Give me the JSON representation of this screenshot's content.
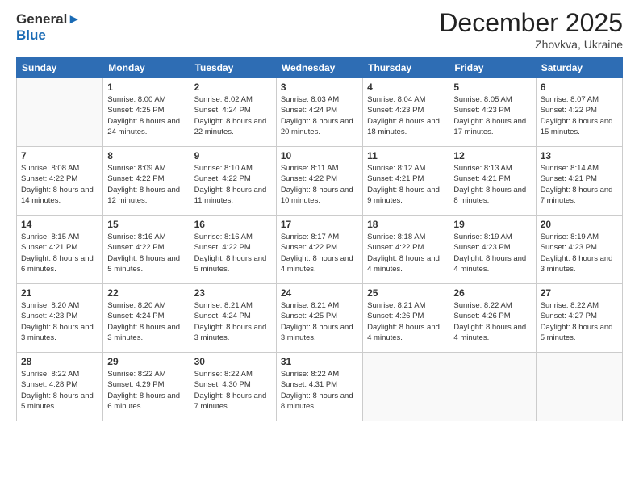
{
  "header": {
    "logo_line1": "General",
    "logo_line2": "Blue",
    "month": "December 2025",
    "location": "Zhovkva, Ukraine"
  },
  "weekdays": [
    "Sunday",
    "Monday",
    "Tuesday",
    "Wednesday",
    "Thursday",
    "Friday",
    "Saturday"
  ],
  "weeks": [
    [
      {
        "day": "",
        "empty": true
      },
      {
        "day": "1",
        "sunrise": "8:00 AM",
        "sunset": "4:25 PM",
        "daylight": "8 hours and 24 minutes."
      },
      {
        "day": "2",
        "sunrise": "8:02 AM",
        "sunset": "4:24 PM",
        "daylight": "8 hours and 22 minutes."
      },
      {
        "day": "3",
        "sunrise": "8:03 AM",
        "sunset": "4:24 PM",
        "daylight": "8 hours and 20 minutes."
      },
      {
        "day": "4",
        "sunrise": "8:04 AM",
        "sunset": "4:23 PM",
        "daylight": "8 hours and 18 minutes."
      },
      {
        "day": "5",
        "sunrise": "8:05 AM",
        "sunset": "4:23 PM",
        "daylight": "8 hours and 17 minutes."
      },
      {
        "day": "6",
        "sunrise": "8:07 AM",
        "sunset": "4:22 PM",
        "daylight": "8 hours and 15 minutes."
      }
    ],
    [
      {
        "day": "7",
        "sunrise": "8:08 AM",
        "sunset": "4:22 PM",
        "daylight": "8 hours and 14 minutes."
      },
      {
        "day": "8",
        "sunrise": "8:09 AM",
        "sunset": "4:22 PM",
        "daylight": "8 hours and 12 minutes."
      },
      {
        "day": "9",
        "sunrise": "8:10 AM",
        "sunset": "4:22 PM",
        "daylight": "8 hours and 11 minutes."
      },
      {
        "day": "10",
        "sunrise": "8:11 AM",
        "sunset": "4:22 PM",
        "daylight": "8 hours and 10 minutes."
      },
      {
        "day": "11",
        "sunrise": "8:12 AM",
        "sunset": "4:21 PM",
        "daylight": "8 hours and 9 minutes."
      },
      {
        "day": "12",
        "sunrise": "8:13 AM",
        "sunset": "4:21 PM",
        "daylight": "8 hours and 8 minutes."
      },
      {
        "day": "13",
        "sunrise": "8:14 AM",
        "sunset": "4:21 PM",
        "daylight": "8 hours and 7 minutes."
      }
    ],
    [
      {
        "day": "14",
        "sunrise": "8:15 AM",
        "sunset": "4:21 PM",
        "daylight": "8 hours and 6 minutes."
      },
      {
        "day": "15",
        "sunrise": "8:16 AM",
        "sunset": "4:22 PM",
        "daylight": "8 hours and 5 minutes."
      },
      {
        "day": "16",
        "sunrise": "8:16 AM",
        "sunset": "4:22 PM",
        "daylight": "8 hours and 5 minutes."
      },
      {
        "day": "17",
        "sunrise": "8:17 AM",
        "sunset": "4:22 PM",
        "daylight": "8 hours and 4 minutes."
      },
      {
        "day": "18",
        "sunrise": "8:18 AM",
        "sunset": "4:22 PM",
        "daylight": "8 hours and 4 minutes."
      },
      {
        "day": "19",
        "sunrise": "8:19 AM",
        "sunset": "4:23 PM",
        "daylight": "8 hours and 4 minutes."
      },
      {
        "day": "20",
        "sunrise": "8:19 AM",
        "sunset": "4:23 PM",
        "daylight": "8 hours and 3 minutes."
      }
    ],
    [
      {
        "day": "21",
        "sunrise": "8:20 AM",
        "sunset": "4:23 PM",
        "daylight": "8 hours and 3 minutes."
      },
      {
        "day": "22",
        "sunrise": "8:20 AM",
        "sunset": "4:24 PM",
        "daylight": "8 hours and 3 minutes."
      },
      {
        "day": "23",
        "sunrise": "8:21 AM",
        "sunset": "4:24 PM",
        "daylight": "8 hours and 3 minutes."
      },
      {
        "day": "24",
        "sunrise": "8:21 AM",
        "sunset": "4:25 PM",
        "daylight": "8 hours and 3 minutes."
      },
      {
        "day": "25",
        "sunrise": "8:21 AM",
        "sunset": "4:26 PM",
        "daylight": "8 hours and 4 minutes."
      },
      {
        "day": "26",
        "sunrise": "8:22 AM",
        "sunset": "4:26 PM",
        "daylight": "8 hours and 4 minutes."
      },
      {
        "day": "27",
        "sunrise": "8:22 AM",
        "sunset": "4:27 PM",
        "daylight": "8 hours and 5 minutes."
      }
    ],
    [
      {
        "day": "28",
        "sunrise": "8:22 AM",
        "sunset": "4:28 PM",
        "daylight": "8 hours and 5 minutes."
      },
      {
        "day": "29",
        "sunrise": "8:22 AM",
        "sunset": "4:29 PM",
        "daylight": "8 hours and 6 minutes."
      },
      {
        "day": "30",
        "sunrise": "8:22 AM",
        "sunset": "4:30 PM",
        "daylight": "8 hours and 7 minutes."
      },
      {
        "day": "31",
        "sunrise": "8:22 AM",
        "sunset": "4:31 PM",
        "daylight": "8 hours and 8 minutes."
      },
      {
        "day": "",
        "empty": true
      },
      {
        "day": "",
        "empty": true
      },
      {
        "day": "",
        "empty": true
      }
    ]
  ]
}
